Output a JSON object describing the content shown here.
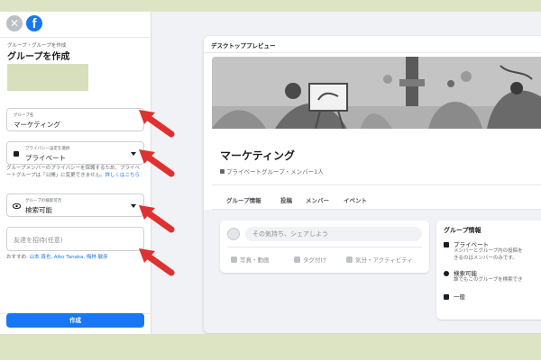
{
  "colors": {
    "brand": "#1877f2",
    "arrow": "#e03030",
    "outer": "#dde4c4"
  },
  "sidebar": {
    "close_icon_glyph": "✕",
    "logo_glyph": "f",
    "breadcrumb": "グループ・グループを作成",
    "title": "グループを作成",
    "name_field": {
      "label": "グループ名",
      "value": "マーケティング"
    },
    "privacy_field": {
      "label": "プライバシー設定を選択",
      "value": "プライベート"
    },
    "privacy_help": "グループメンバーのプライバシーを保護するため、プライベートグループは「公開」に変更できません。",
    "privacy_help_link": "詳しくはこちら",
    "visibility_field": {
      "label": "グループの検索可否",
      "value": "検索可能"
    },
    "invite_field": {
      "placeholder": "友達を招待(任意)"
    },
    "suggest_prefix": "おすすめ:",
    "suggest_names": "山本 真也, Aiko Tanaka, 梅林 敏彦",
    "create_button": "作成"
  },
  "preview": {
    "title": "デスクトッププレビュー",
    "group_name": "マーケティング",
    "group_meta": "プライベートグループ・メンバー1人",
    "tabs": [
      "グループ情報",
      "投稿",
      "メンバー",
      "イベント"
    ],
    "composer": {
      "placeholder": "その気持ち、シェアしよう",
      "actions": [
        "写真・動画",
        "タグ付け",
        "気分・アクティビティ"
      ]
    },
    "info": {
      "title": "グループ情報",
      "privacy_title": "プライベート",
      "privacy_desc": [
        "メンバーとグループ内の投稿を",
        "きるのはメンバーのみです。"
      ],
      "visibility_title": "検索可能",
      "visibility_desc": "誰でもこのグループを検索でき",
      "general": "一般"
    }
  }
}
